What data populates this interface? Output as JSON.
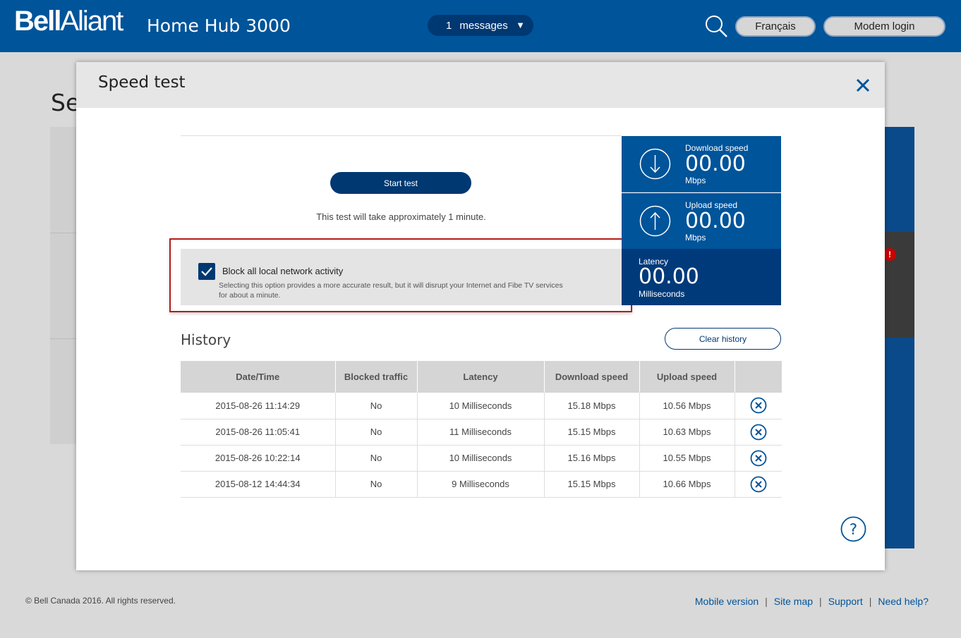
{
  "header": {
    "brand_bold": "Bell",
    "brand_thin": "Aliant",
    "product": "Home Hub 3000",
    "messages_count": "1",
    "messages_label": "messages",
    "lang_label": "Français",
    "login_label": "Modem login"
  },
  "background": {
    "page_title_fragment": "Se"
  },
  "modal": {
    "title": "Speed test",
    "start_label": "Start test",
    "note": "This test will take approximately 1 minute.",
    "block": {
      "label": "Block all local network activity",
      "description": "Selecting this option provides a more accurate result, but it will disrupt your Internet and Fibe TV services for about a minute.",
      "checked": true
    },
    "download": {
      "label": "Download speed",
      "value": "00.00",
      "unit": "Mbps"
    },
    "upload": {
      "label": "Upload speed",
      "value": "00.00",
      "unit": "Mbps"
    },
    "latency": {
      "label": "Latency",
      "value": "00.00",
      "unit": "Milliseconds"
    },
    "history_title": "History",
    "clear_label": "Clear history",
    "columns": [
      "Date/Time",
      "Blocked traffic",
      "Latency",
      "Download speed",
      "Upload speed"
    ],
    "rows": [
      [
        "2015-08-26 11:14:29",
        "No",
        "10 Milliseconds",
        "15.18 Mbps",
        "10.56 Mbps"
      ],
      [
        "2015-08-26 11:05:41",
        "No",
        "11 Milliseconds",
        "15.15 Mbps",
        "10.63 Mbps"
      ],
      [
        "2015-08-26 10:22:14",
        "No",
        "10 Milliseconds",
        "15.16 Mbps",
        "10.55 Mbps"
      ],
      [
        "2015-08-12 14:44:34",
        "No",
        "9 Milliseconds",
        "15.15 Mbps",
        "10.66 Mbps"
      ]
    ]
  },
  "footer": {
    "copyright": "© Bell Canada 2016. All rights reserved.",
    "links": [
      "Mobile version",
      "Site map",
      "Support",
      "Need help?"
    ]
  },
  "colors": {
    "brand_blue": "#00549a",
    "dark_blue": "#003872",
    "highlight_red": "#b71c1c"
  }
}
